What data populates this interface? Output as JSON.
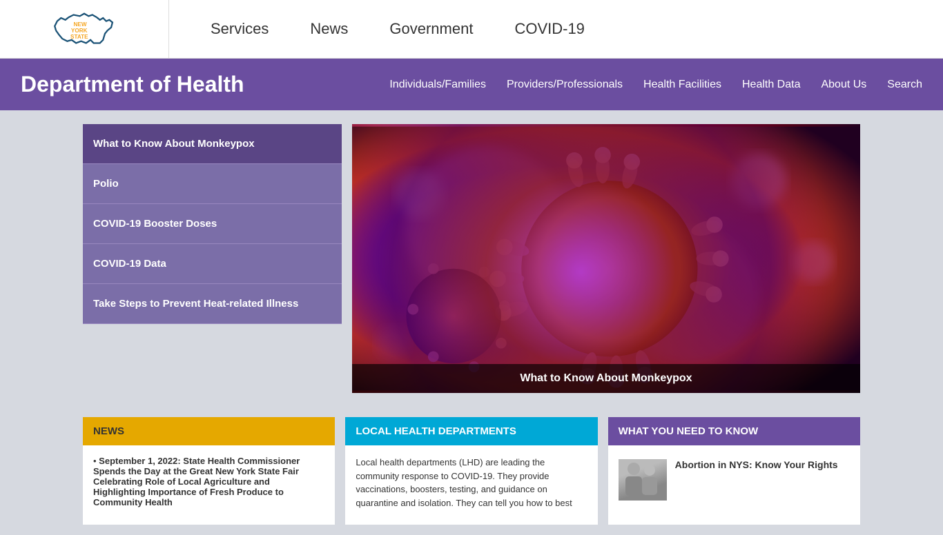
{
  "topNav": {
    "links": [
      {
        "label": "Services",
        "id": "services"
      },
      {
        "label": "News",
        "id": "news"
      },
      {
        "label": "Government",
        "id": "government"
      },
      {
        "label": "COVID-19",
        "id": "covid19"
      }
    ]
  },
  "deptHeader": {
    "title": "Department of Health",
    "navLinks": [
      {
        "label": "Individuals/Families"
      },
      {
        "label": "Providers/Professionals"
      },
      {
        "label": "Health Facilities"
      },
      {
        "label": "Health Data"
      },
      {
        "label": "About Us"
      },
      {
        "label": "Search"
      }
    ]
  },
  "sidebar": {
    "links": [
      {
        "label": "What to Know About Monkeypox"
      },
      {
        "label": "Polio"
      },
      {
        "label": "COVID-19 Booster Doses"
      },
      {
        "label": "COVID-19 Data"
      },
      {
        "label": "Take Steps to Prevent Heat-related Illness"
      }
    ]
  },
  "hero": {
    "caption": "What to Know About Monkeypox"
  },
  "bottomSections": {
    "news": {
      "header": "NEWS",
      "item": "September 1, 2022: State Health Commissioner Spends the Day at the Great New York State Fair Celebrating Role of Local Agriculture and Highlighting Importance of Fresh Produce to Community Health"
    },
    "lhd": {
      "header": "LOCAL HEALTH DEPARTMENTS",
      "body": "Local health departments (LHD) are leading the community response to COVID-19. They provide vaccinations, boosters, testing, and guidance on quarantine and isolation. They can tell you how to best"
    },
    "know": {
      "header": "WHAT YOU NEED TO KNOW",
      "item": "Abortion in NYS: Know Your Rights"
    }
  },
  "logo": {
    "line1": "NEW",
    "line2": "YORK",
    "line3": "STATE"
  }
}
